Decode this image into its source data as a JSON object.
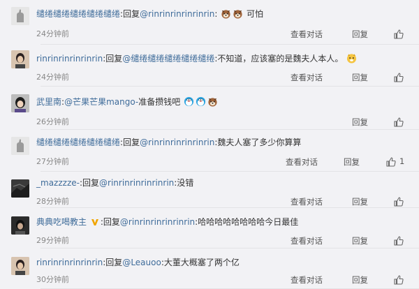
{
  "comments": [
    {
      "username": "缱绻缱绻缱绻缱绻缱绻",
      "sep": ":",
      "reply_prefix": "回复",
      "mention": "@rinrinrinrinrinrin",
      "mention_sep": ":",
      "body": "可怕",
      "emojis": [
        "dog-icon",
        "dog-icon"
      ],
      "time": "24分钟前",
      "view_conversation": "查看对话",
      "reply": "回复",
      "likes": ""
    },
    {
      "username": "rinrinrinrinrinrin",
      "sep": ":",
      "reply_prefix": "回复",
      "mention": "@缱绻缱绻缱绻缱绻缱绻",
      "mention_sep": ":",
      "body": "不知道，应该塞的是魏夫人本人。",
      "emojis": [
        "dog-icon"
      ],
      "time": "24分钟前",
      "view_conversation": "查看对话",
      "reply": "回复",
      "likes": ""
    },
    {
      "username": "武里南",
      "sep": ":",
      "mention": "@芒果芒果mango-",
      "body": "准备攒钱吧",
      "emojis": [
        "doraemon-icon",
        "doraemon-icon",
        "dog-icon"
      ],
      "time": "26分钟前",
      "reply": "回复",
      "likes": ""
    },
    {
      "username": "缱绻缱绻缱绻缱绻缱绻",
      "sep": ":",
      "reply_prefix": "回复",
      "mention": "@rinrinrinrinrinrin",
      "mention_sep": ":",
      "body": "魏夫人塞了多少你算算",
      "time": "27分钟前",
      "view_conversation": "查看对话",
      "reply": "回复",
      "likes": "1"
    },
    {
      "username": "_mazzzze-",
      "sep": ":",
      "reply_prefix": "回复",
      "mention": "@rinrinrinrinrinrin",
      "mention_sep": ":",
      "body": "没错",
      "time": "28分钟前",
      "view_conversation": "查看对话",
      "reply": "回复",
      "likes": ""
    },
    {
      "username": "典典吃喝教主",
      "sep": ":",
      "reply_prefix": "回复",
      "mention": "@rinrinrinrinrinrin",
      "mention_sep": ":",
      "body": "哈哈哈哈哈哈哈哈今日最佳",
      "verified": "vip-v-icon",
      "time": "29分钟前",
      "view_conversation": "查看对话",
      "reply": "回复",
      "likes": ""
    },
    {
      "username": "rinrinrinrinrinrin",
      "sep": ":",
      "reply_prefix": "回复",
      "mention": "@Leauoo",
      "mention_sep": ":",
      "body": "大董大概塞了两个亿",
      "time": "30分钟前",
      "view_conversation": "查看对话",
      "reply": "回复",
      "likes": ""
    }
  ],
  "colors": {
    "link": "#3f6c9a",
    "text": "#333333",
    "muted": "#888888",
    "background": "#f2f2f5",
    "vip_badge": "#f0a500"
  }
}
